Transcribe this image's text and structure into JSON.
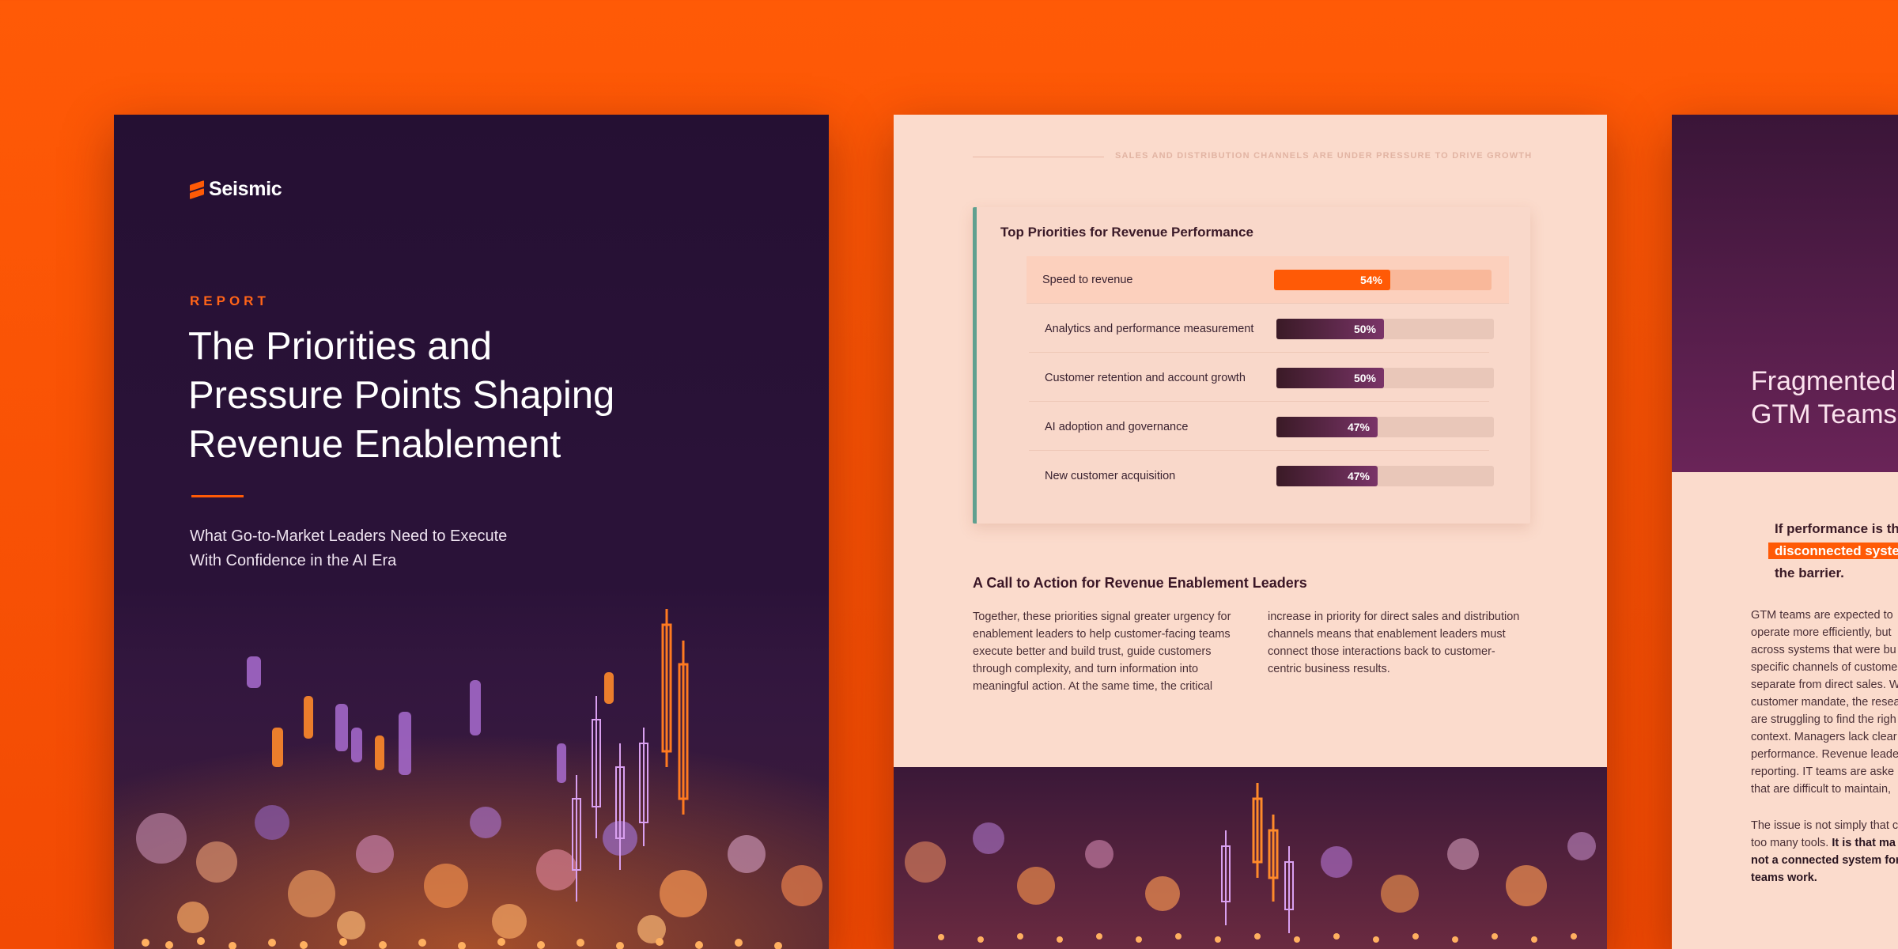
{
  "cover": {
    "logo_text": "Seismic",
    "eyebrow": "REPORT",
    "title_lines": [
      "The Priorities and",
      "Pressure Points Shaping",
      "Revenue Enablement"
    ],
    "subtitle_lines": [
      "What Go-to-Market Leaders Need to Execute",
      "With Confidence in the AI Era"
    ]
  },
  "middle": {
    "header": "SALES AND DISTRIBUTION CHANNELS ARE UNDER PRESSURE TO DRIVE GROWTH",
    "card_title": "Top Priorities for Revenue Performance",
    "rows": [
      {
        "label": "Speed to revenue",
        "value": 54,
        "value_text": "54%"
      },
      {
        "label": "Analytics and performance measurement",
        "value": 50,
        "value_text": "50%"
      },
      {
        "label": "Customer retention and account growth",
        "value": 50,
        "value_text": "50%"
      },
      {
        "label": "AI adoption and governance",
        "value": 47,
        "value_text": "47%"
      },
      {
        "label": "New customer acquisition",
        "value": 47,
        "value_text": "47%"
      }
    ],
    "cta_title": "A Call to Action for Revenue Enablement Leaders",
    "col1_lines": [
      "Together, these priorities signal greater urgency for",
      "enablement leaders to help customer-facing teams",
      "execute better and build trust, guide customers",
      "through complexity, and turn information into",
      "meaningful action. At the same time, the critical"
    ],
    "col2_lines": [
      "increase in priority for direct sales and distribution",
      "channels means that enablement leaders must",
      "connect those interactions back to customer-",
      "centric business results."
    ]
  },
  "right": {
    "title_lines": [
      "Fragmented",
      "GTM Teams"
    ],
    "quote_line1": "If performance is th",
    "quote_highlight": "disconnected syste",
    "quote_line3": "the barrier.",
    "para1_lines": [
      "GTM teams are expected to",
      "operate more efficiently, but",
      "across systems that were bu",
      "specific channels of custome",
      "separate from direct sales. W",
      "customer mandate, the resea",
      "are struggling to find the righ",
      "context. Managers lack clear",
      "performance. Revenue leade",
      "reporting. IT teams are aske",
      "that are difficult to maintain,"
    ],
    "para2_line1": "The issue is not simply that c",
    "para2_line2_plain": "too many tools. ",
    "para2_line2_bold": "It is that ma",
    "para2_line3": "not a connected system for",
    "para2_line4": "teams work."
  },
  "colors": {
    "brand_orange": "#ff5a06",
    "deep_purple": "#2a1238",
    "accent_teal": "#5fa08f"
  }
}
